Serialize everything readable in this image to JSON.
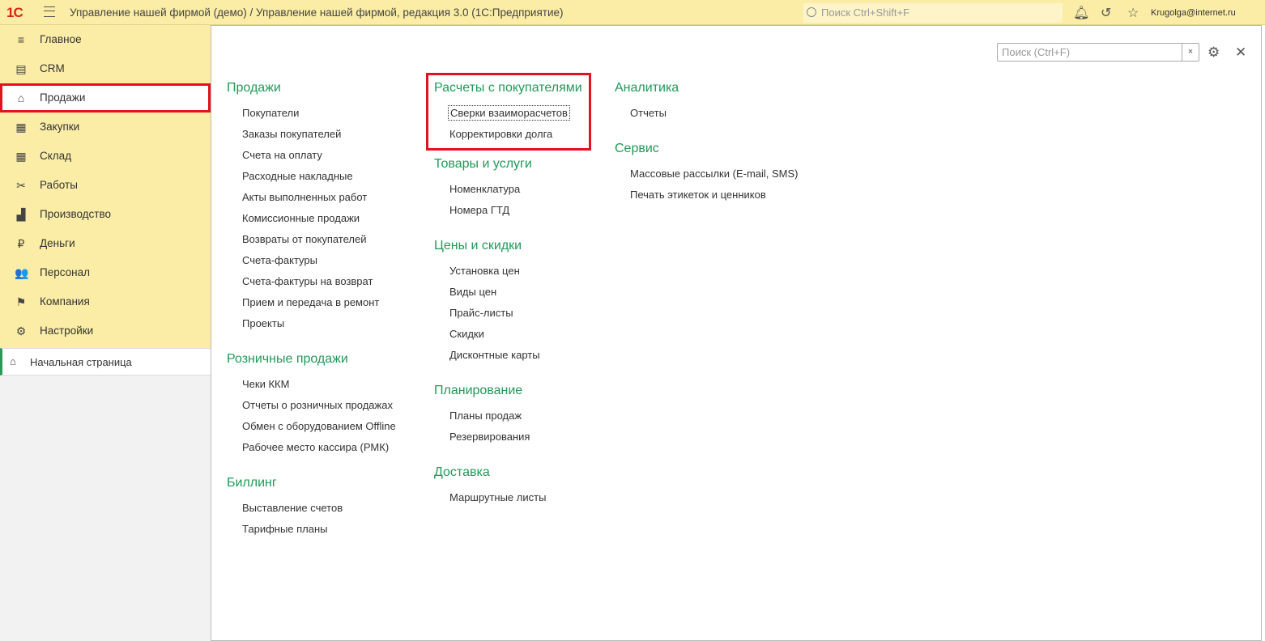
{
  "topbar": {
    "logo": "1С",
    "title": "Управление нашей фирмой (демо) / Управление нашей фирмой, редакция 3.0  (1С:Предприятие)",
    "search_placeholder": "Поиск Ctrl+Shift+F",
    "user": "Krugolga@internet.ru"
  },
  "sidebar": {
    "items": [
      {
        "label": "Главное",
        "icon": "≡"
      },
      {
        "label": "CRM",
        "icon": "▤"
      },
      {
        "label": "Продажи",
        "icon": "⌂"
      },
      {
        "label": "Закупки",
        "icon": "▦"
      },
      {
        "label": "Склад",
        "icon": "▦"
      },
      {
        "label": "Работы",
        "icon": "✂"
      },
      {
        "label": "Производство",
        "icon": "▟"
      },
      {
        "label": "Деньги",
        "icon": "₽"
      },
      {
        "label": "Персонал",
        "icon": "👥"
      },
      {
        "label": "Компания",
        "icon": "⚑"
      },
      {
        "label": "Настройки",
        "icon": "⚙"
      }
    ],
    "active_index": 2,
    "home": "Начальная страница"
  },
  "main": {
    "search_placeholder": "Поиск (Ctrl+F)",
    "clear": "×",
    "columns": [
      [
        {
          "title": "Продажи",
          "items": [
            "Покупатели",
            "Заказы покупателей",
            "Счета на оплату",
            "Расходные накладные",
            "Акты выполненных работ",
            "Комиссионные продажи",
            "Возвраты от покупателей",
            "Счета-фактуры",
            "Счета-фактуры на возврат",
            "Прием и передача в ремонт",
            "Проекты"
          ]
        },
        {
          "title": "Розничные продажи",
          "items": [
            "Чеки ККМ",
            "Отчеты о розничных продажах",
            "Обмен с оборудованием Offline",
            "Рабочее место кассира (РМК)"
          ]
        },
        {
          "title": "Биллинг",
          "items": [
            "Выставление счетов",
            "Тарифные планы"
          ]
        }
      ],
      [
        {
          "title": "Расчеты с покупателями",
          "items": [
            "Сверки взаиморасчетов",
            "Корректировки долга"
          ],
          "highlighted": true
        },
        {
          "title": "Товары и услуги",
          "items": [
            "Номенклатура",
            "Номера ГТД"
          ]
        },
        {
          "title": "Цены и скидки",
          "items": [
            "Установка цен",
            "Виды цен",
            "Прайс-листы",
            "Скидки",
            "Дисконтные карты"
          ]
        },
        {
          "title": "Планирование",
          "items": [
            "Планы продаж",
            "Резервирования"
          ]
        },
        {
          "title": "Доставка",
          "items": [
            "Маршрутные листы"
          ]
        }
      ],
      [
        {
          "title": "Аналитика",
          "items": [
            "Отчеты"
          ]
        },
        {
          "title": "Сервис",
          "items": [
            "Массовые рассылки (E-mail, SMS)",
            "Печать этикеток и ценников"
          ]
        }
      ]
    ]
  }
}
